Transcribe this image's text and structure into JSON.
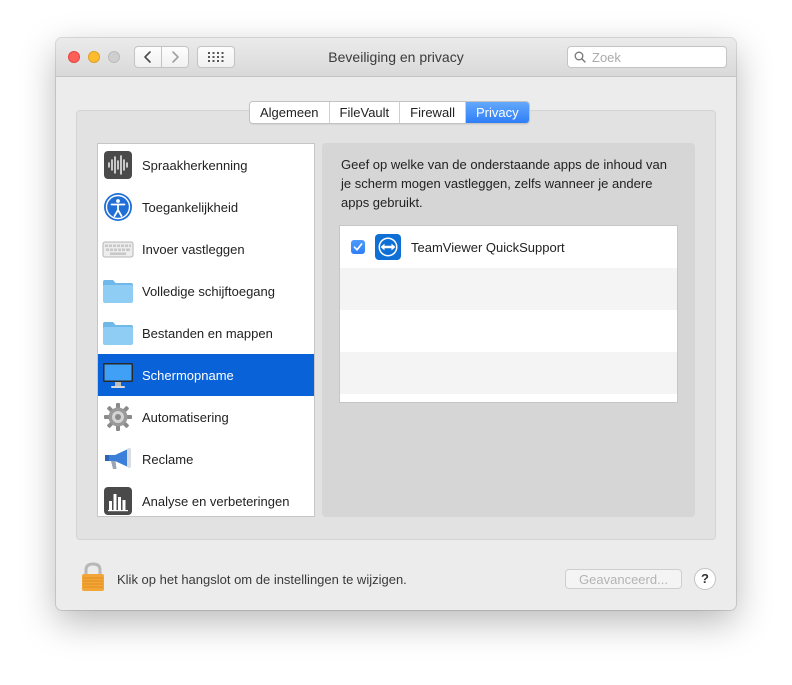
{
  "window": {
    "title": "Beveiliging en privacy",
    "search_placeholder": "Zoek"
  },
  "tabs": [
    {
      "label": "Algemeen",
      "active": false
    },
    {
      "label": "FileVault",
      "active": false
    },
    {
      "label": "Firewall",
      "active": false
    },
    {
      "label": "Privacy",
      "active": true
    }
  ],
  "sidebar": {
    "items": [
      {
        "label": "Spraakherkenning",
        "icon": "waveform-icon"
      },
      {
        "label": "Toegankelijkheid",
        "icon": "accessibility-icon"
      },
      {
        "label": "Invoer vastleggen",
        "icon": "keyboard-icon"
      },
      {
        "label": "Volledige schijftoegang",
        "icon": "folder-icon"
      },
      {
        "label": "Bestanden en mappen",
        "icon": "folder-icon"
      },
      {
        "label": "Schermopname",
        "icon": "display-icon",
        "selected": true
      },
      {
        "label": "Automatisering",
        "icon": "gear-icon"
      },
      {
        "label": "Reclame",
        "icon": "megaphone-icon"
      },
      {
        "label": "Analyse en verbeteringen",
        "icon": "bar-chart-icon"
      }
    ]
  },
  "content": {
    "description": "Geef op welke van de onderstaande apps de inhoud van je scherm mogen vastleggen, zelfs wanneer je andere apps gebruikt.",
    "apps": [
      {
        "name": "TeamViewer QuickSupport",
        "checked": true,
        "icon": "teamviewer-icon"
      }
    ]
  },
  "footer": {
    "lock_text": "Klik op het hangslot om de instellingen te wijzigen.",
    "advanced_label": "Geavanceerd...",
    "help_label": "?"
  },
  "colors": {
    "accent": "#2f7ef7",
    "selection": "#0a62d8"
  }
}
